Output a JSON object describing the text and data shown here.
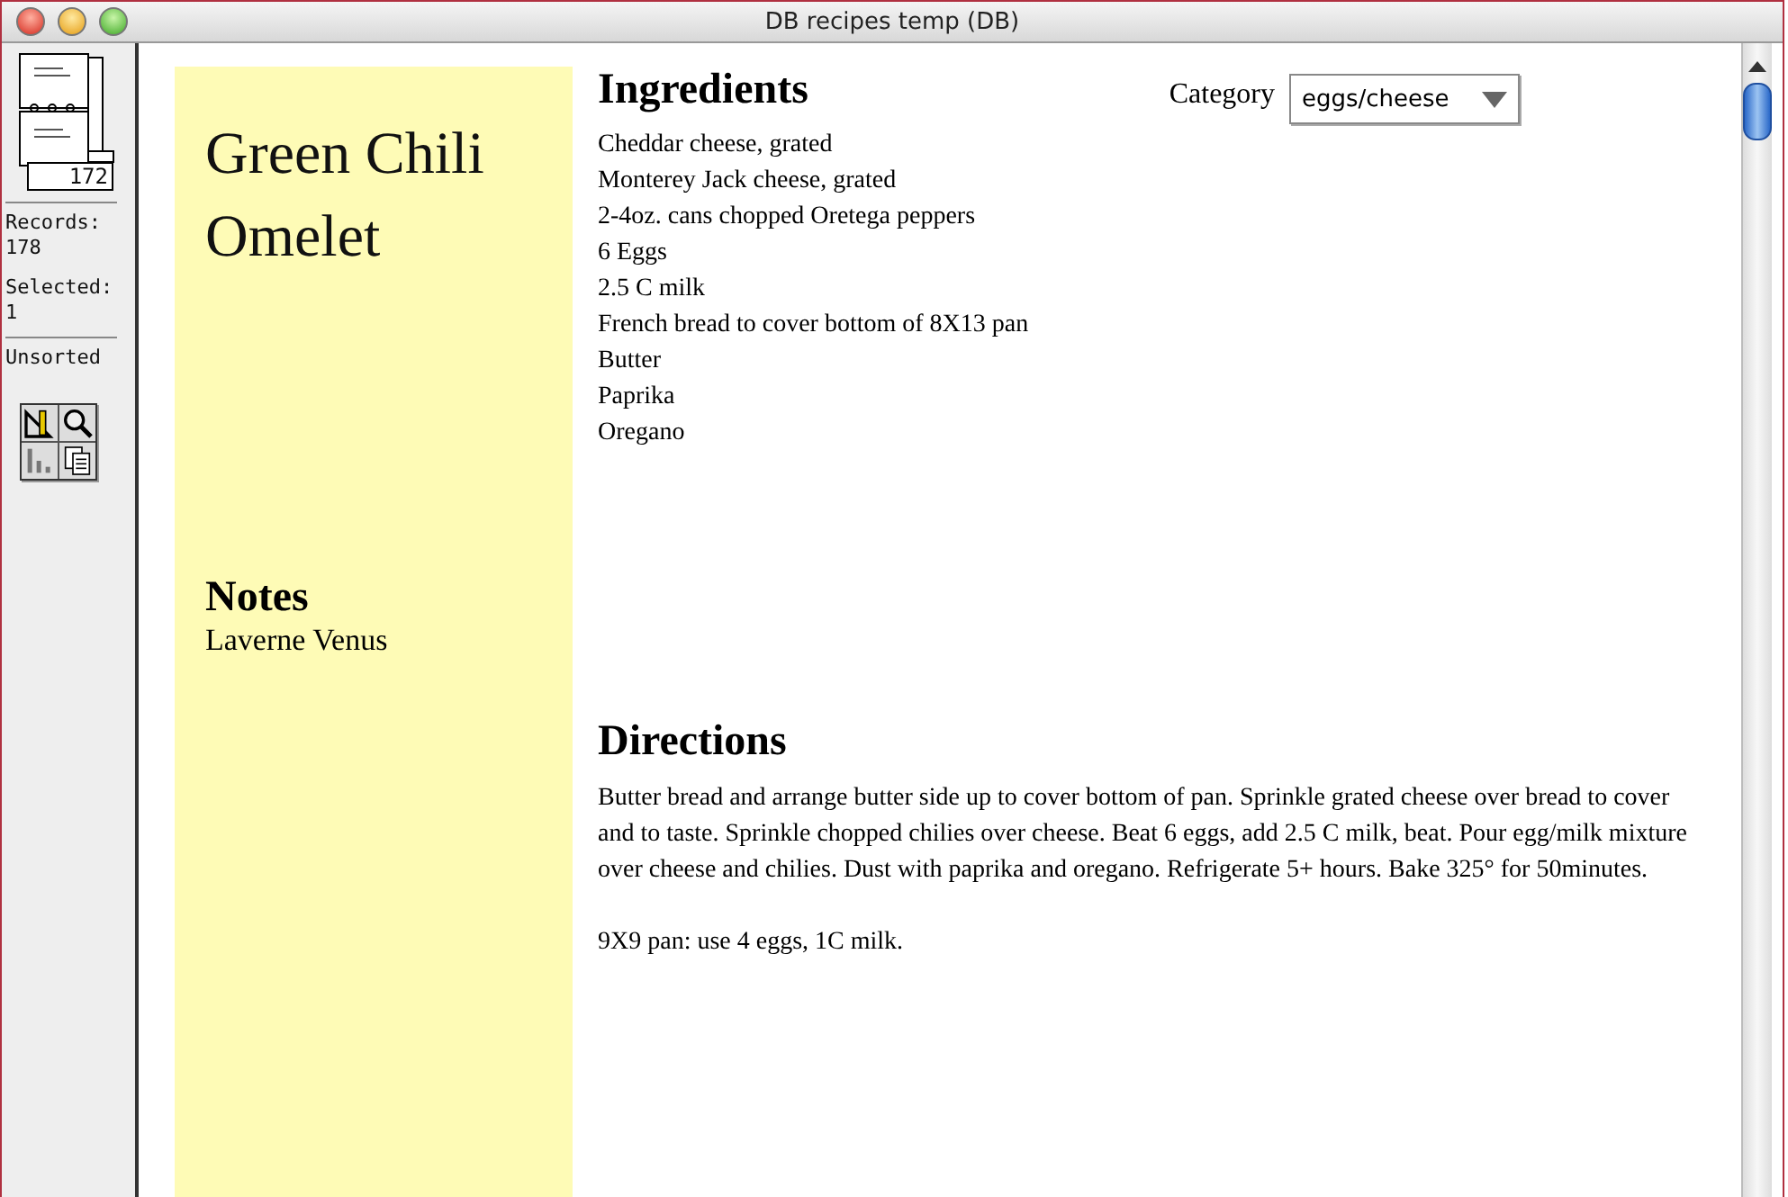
{
  "window": {
    "title": "DB recipes temp (DB)"
  },
  "sidebar": {
    "record_number": "172",
    "records_label": "Records:",
    "records": "178",
    "selected_label": "Selected:",
    "selected": "1",
    "sort": "Unsorted"
  },
  "record": {
    "title": "Green Chili Omelet",
    "notes_heading": "Notes",
    "notes": "Laverne Venus",
    "ingredients_heading": "Ingredients",
    "category_label": "Category",
    "category": "eggs/cheese",
    "ingredients": [
      "Cheddar cheese, grated",
      "Monterey Jack cheese, grated",
      "2-4oz. cans chopped Oretega peppers",
      "6 Eggs",
      "2.5 C milk",
      "French bread to cover bottom of 8X13 pan",
      "Butter",
      "Paprika",
      "Oregano"
    ],
    "directions_heading": "Directions",
    "directions": [
      "Butter bread and arrange butter side up to cover bottom of pan. Sprinkle grated cheese over bread to cover and to taste. Sprinkle chopped chilies over cheese. Beat 6 eggs, add 2.5 C milk, beat. Pour egg/milk mixture over cheese and chilies. Dust with paprika and oregano. Refrigerate 5+ hours. Bake 325° for 50minutes.",
      "9X9 pan: use 4 eggs, 1C milk."
    ]
  }
}
